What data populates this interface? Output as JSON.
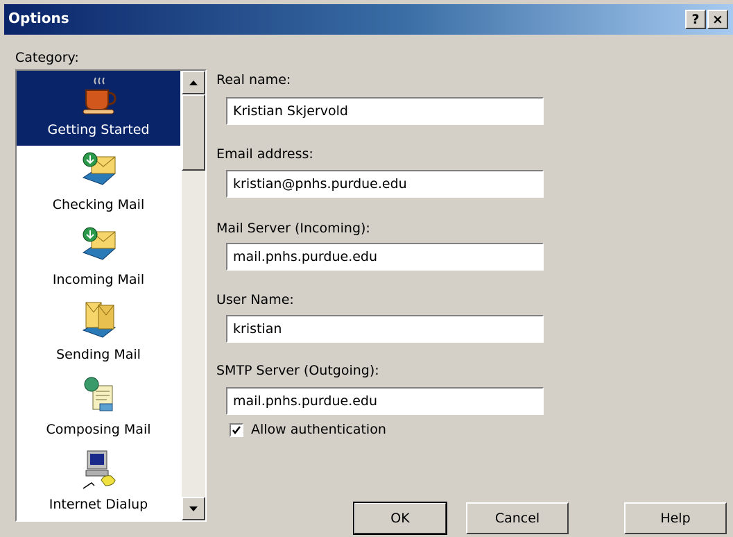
{
  "window": {
    "title": "Options"
  },
  "title_buttons": {
    "help": "?",
    "close": "×"
  },
  "category_label": "Category:",
  "categories": [
    {
      "label": "Getting Started",
      "icon": "coffee-cup-icon",
      "selected": true
    },
    {
      "label": "Checking Mail",
      "icon": "mail-download-icon",
      "selected": false
    },
    {
      "label": "Incoming Mail",
      "icon": "mail-inbox-icon",
      "selected": false
    },
    {
      "label": "Sending Mail",
      "icon": "mail-send-icon",
      "selected": false
    },
    {
      "label": "Composing Mail",
      "icon": "compose-mail-icon",
      "selected": false
    },
    {
      "label": "Internet Dialup",
      "icon": "dialup-computer-icon",
      "selected": false
    }
  ],
  "fields": {
    "real_name": {
      "label": "Real name:",
      "value": "Kristian Skjervold"
    },
    "email": {
      "label": "Email address:",
      "value": "kristian@pnhs.purdue.edu"
    },
    "incoming": {
      "label": "Mail Server (Incoming):",
      "value": "mail.pnhs.purdue.edu"
    },
    "user": {
      "label": "User Name:",
      "value": "kristian"
    },
    "smtp": {
      "label": "SMTP Server (Outgoing):",
      "value": "mail.pnhs.purdue.edu"
    }
  },
  "auth": {
    "label": "Allow authentication",
    "checked": true
  },
  "buttons": {
    "ok": "OK",
    "cancel": "Cancel",
    "help": "Help"
  },
  "colors": {
    "title_start": "#0a246a",
    "title_end": "#a6caf0",
    "selection": "#0a246a",
    "face": "#d4d0c8"
  }
}
